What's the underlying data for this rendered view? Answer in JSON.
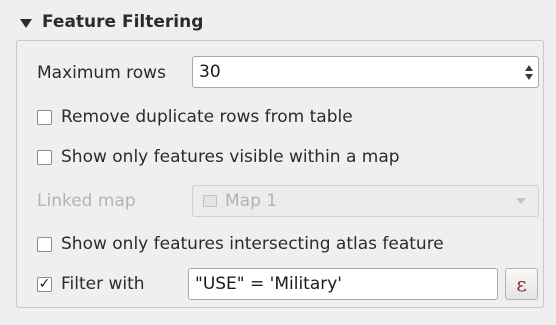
{
  "section": {
    "title": "Feature Filtering",
    "collapse_icon": "triangle-down-icon"
  },
  "max_rows": {
    "label": "Maximum rows",
    "value": "30"
  },
  "remove_duplicates": {
    "label": "Remove duplicate rows from table",
    "checked": false
  },
  "visible_in_map": {
    "label": "Show only features visible within a map",
    "checked": false
  },
  "linked_map": {
    "label": "Linked map",
    "value": "Map 1",
    "enabled": false,
    "icon": "map-icon"
  },
  "intersect_atlas": {
    "label": "Show only features intersecting atlas feature",
    "checked": false
  },
  "filter": {
    "label": "Filter with",
    "checked": true,
    "check_mark": "✓",
    "expression": "\"USE\" = 'Military'",
    "expression_button_icon": "ε"
  },
  "colors": {
    "background": "#efefef",
    "text": "#2b2b2b",
    "disabled_text": "#b3b3b3",
    "expression_icon": "#8a2a2a"
  }
}
